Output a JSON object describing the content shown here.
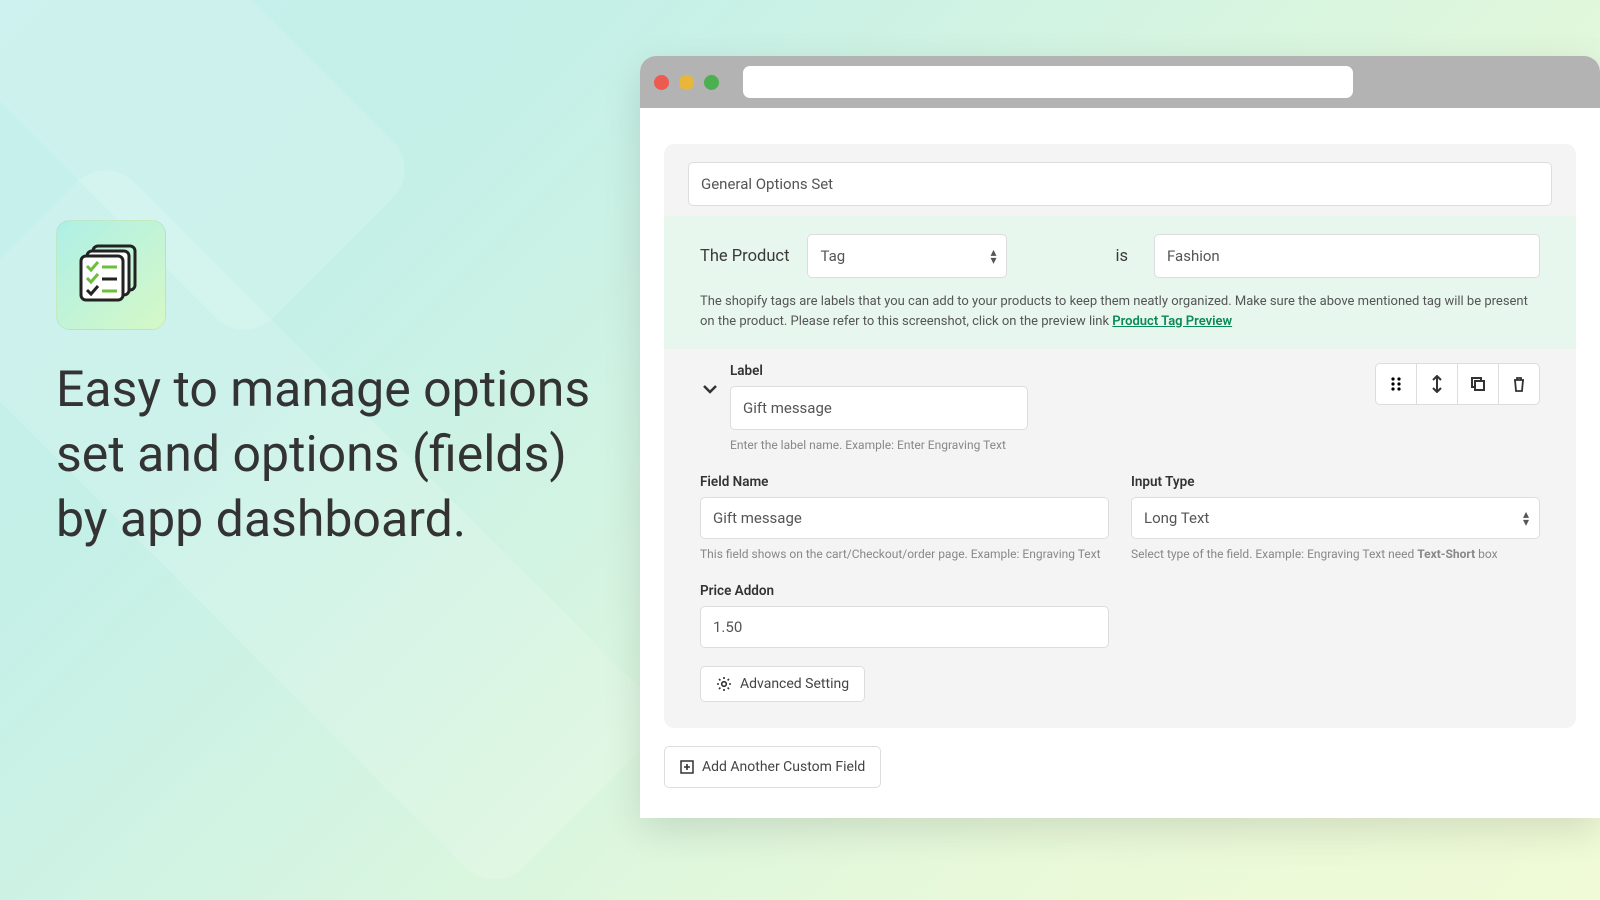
{
  "marketing": {
    "headline": "Easy to manage options set and options (fields) by app dashboard."
  },
  "set": {
    "name": "General Options Set"
  },
  "rule": {
    "prefix": "The Product",
    "selector_value": "Tag",
    "middle": "is",
    "value": "Fashion",
    "help_text": "The shopify tags are labels that you can add to your products to keep them neatly organized. Make sure the above mentioned tag will be present on the product. Please refer to this screenshot, click on the preview link ",
    "link_text": "Product Tag Preview"
  },
  "field": {
    "label_title": "Label",
    "label_value": "Gift message",
    "label_hint": "Enter the label name. Example: Enter Engraving Text",
    "field_name": {
      "title": "Field Name",
      "value": "Gift message",
      "hint": "This field shows on the cart/Checkout/order page. Example: Engraving Text"
    },
    "input_type": {
      "title": "Input Type",
      "value": "Long Text",
      "hint_prefix": "Select type of the field. Example: Engraving Text need ",
      "hint_bold": "Text-Short",
      "hint_suffix": " box"
    },
    "price": {
      "title": "Price Addon",
      "value": "1.50"
    }
  },
  "buttons": {
    "advanced": "Advanced Setting",
    "add_field": "Add Another Custom Field"
  }
}
